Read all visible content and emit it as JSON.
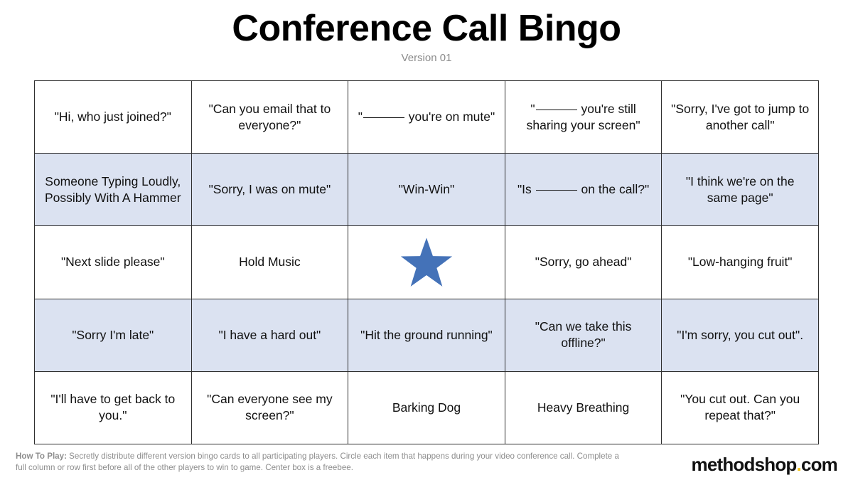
{
  "header": {
    "title": "Conference Call Bingo",
    "version": "Version 01"
  },
  "grid": {
    "rows": [
      {
        "shaded": false,
        "cells": [
          {
            "text": "\"Hi, who just joined?\""
          },
          {
            "text": "\"Can you email that to everyone?\""
          },
          {
            "text": "\"______ you're on mute\"",
            "blank": {
              "before": "\"",
              "after": " you're on mute\""
            }
          },
          {
            "text": "\"______ you're still sharing your screen\"",
            "blank": {
              "before": "\"",
              "after": " you're still sharing your screen\""
            }
          },
          {
            "text": "\"Sorry, I've got to jump to another call\""
          }
        ]
      },
      {
        "shaded": true,
        "cells": [
          {
            "text": "Someone Typing Loudly, Possibly With A Hammer"
          },
          {
            "text": "\"Sorry, I was on mute\""
          },
          {
            "text": "\"Win-Win\""
          },
          {
            "text": "\"Is ______ on the call?\"",
            "blank": {
              "before": "\"Is ",
              "after": " on the call?\""
            }
          },
          {
            "text": "\"I think we're on the same page\""
          }
        ]
      },
      {
        "shaded": false,
        "cells": [
          {
            "text": "\"Next slide please\""
          },
          {
            "text": "Hold Music"
          },
          {
            "text": "",
            "free_space": true,
            "icon": "star-icon",
            "icon_color": "#4472b8"
          },
          {
            "text": "\"Sorry, go ahead\""
          },
          {
            "text": "\"Low-hanging fruit\""
          }
        ]
      },
      {
        "shaded": true,
        "cells": [
          {
            "text": "\"Sorry I'm late\""
          },
          {
            "text": "\"I have a hard out\""
          },
          {
            "text": "\"Hit the ground running\""
          },
          {
            "text": "\"Can we take this offline?\""
          },
          {
            "text": "\"I'm sorry, you cut out\"."
          }
        ]
      },
      {
        "shaded": false,
        "cells": [
          {
            "text": "\"I'll have to get back to you.\""
          },
          {
            "text": "\"Can everyone see my screen?\""
          },
          {
            "text": "Barking Dog"
          },
          {
            "text": "Heavy Breathing"
          },
          {
            "text": "\"You cut out. Can you repeat that?\""
          }
        ]
      }
    ]
  },
  "footer": {
    "how_to_play_label": "How To Play:",
    "how_to_play_text": " Secretly distribute different version bingo cards to all participating players. Circle each item that happens during your video conference call. Complete a full column or row first before all of the other players to win to game. Center box is a freebee.",
    "brand_name": "methodshop",
    "brand_dot": ".",
    "brand_tld": "com"
  },
  "colors": {
    "shaded_row": "#dbe2f1",
    "star": "#4472b8",
    "brand_accent": "#f5c518",
    "grid_border": "#2f2f2f",
    "muted_text": "#8d8d8d"
  }
}
